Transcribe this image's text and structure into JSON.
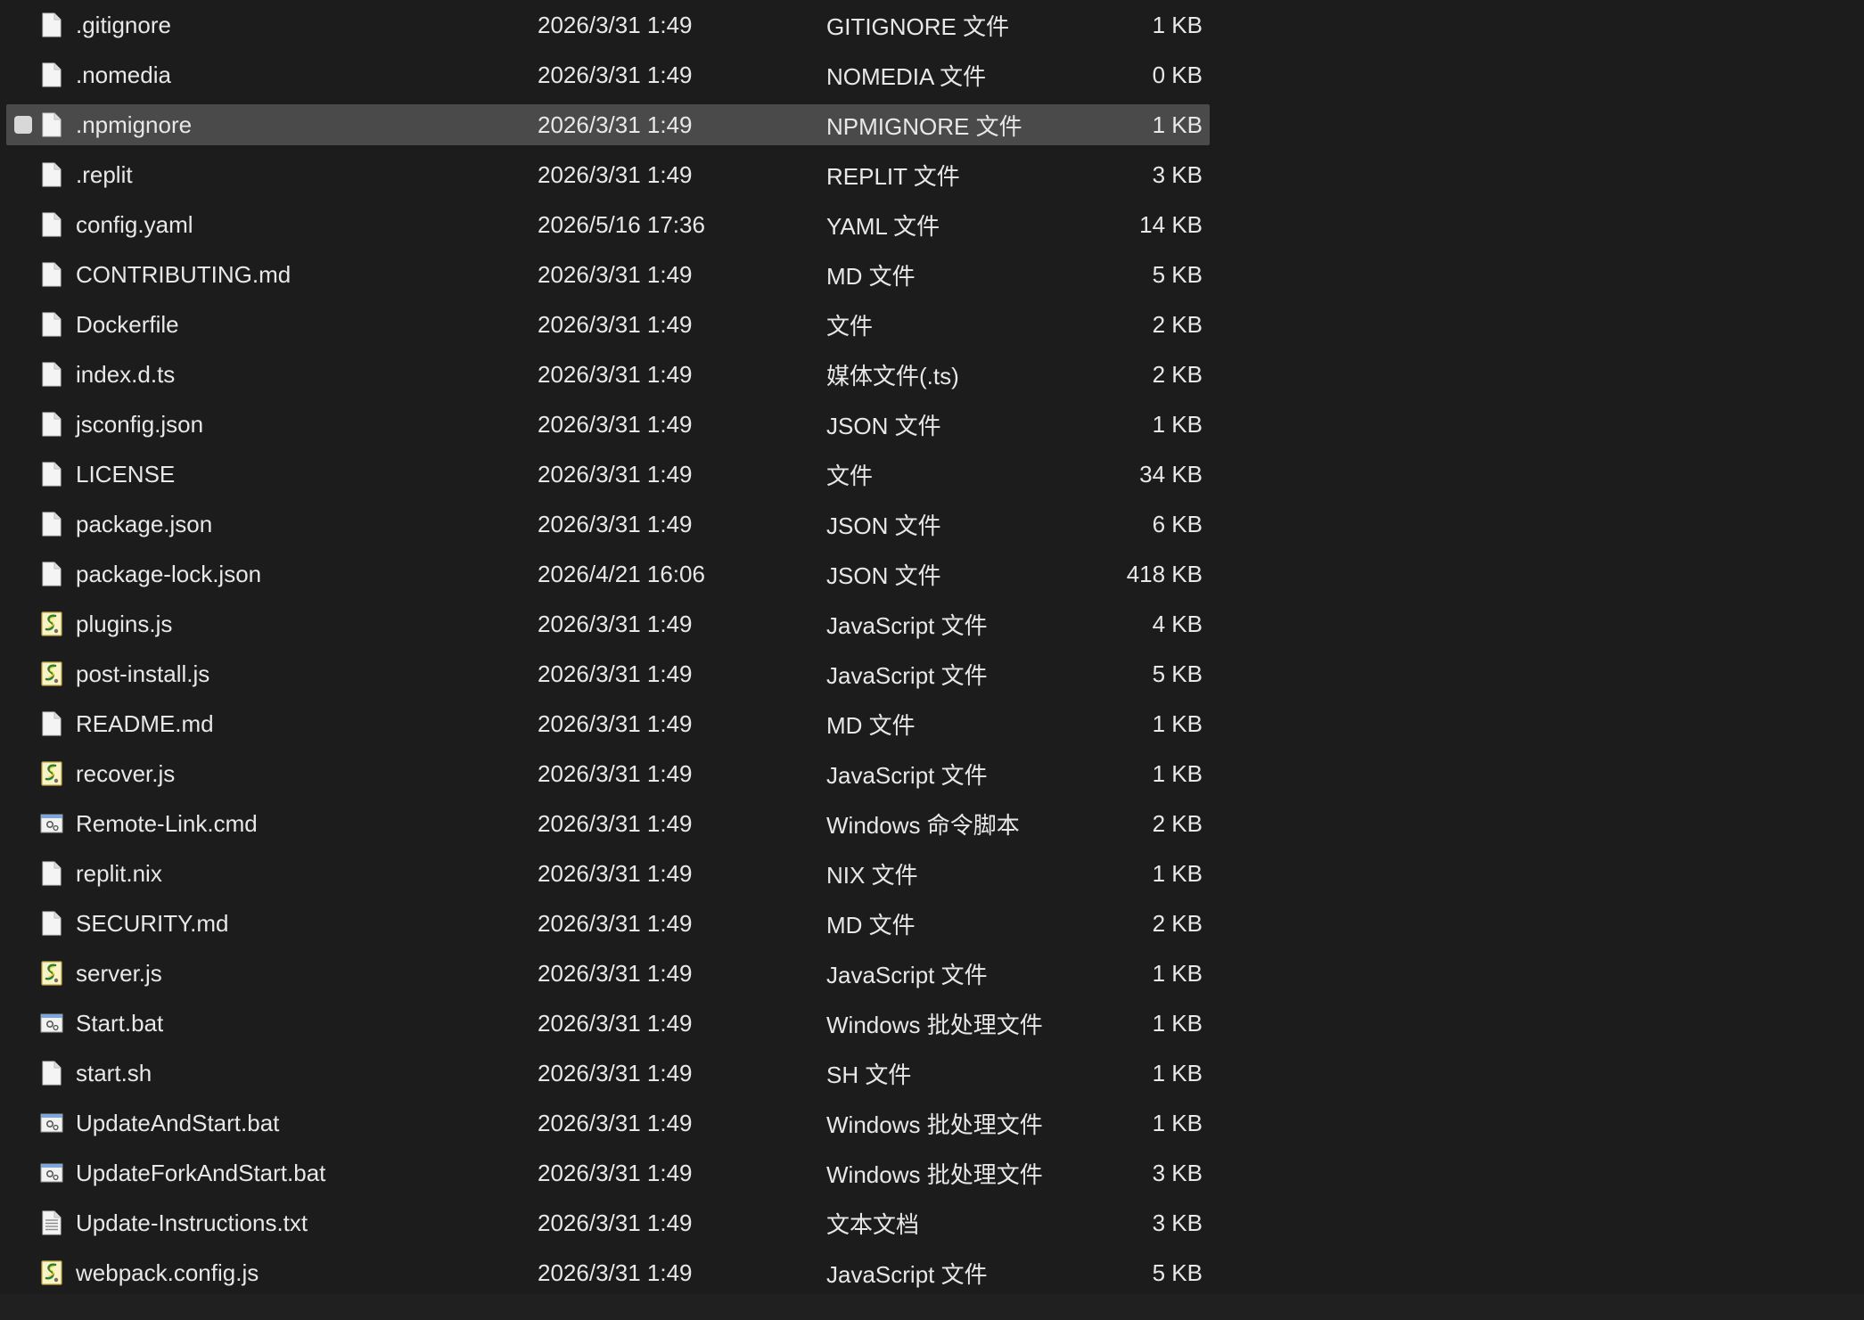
{
  "files": [
    {
      "name": ".gitignore",
      "date": "2026/3/31 1:49",
      "type": "GITIGNORE 文件",
      "size": "1 KB",
      "icon": "generic-file-icon",
      "selected": false
    },
    {
      "name": ".nomedia",
      "date": "2026/3/31 1:49",
      "type": "NOMEDIA 文件",
      "size": "0 KB",
      "icon": "generic-file-icon",
      "selected": false
    },
    {
      "name": ".npmignore",
      "date": "2026/3/31 1:49",
      "type": "NPMIGNORE 文件",
      "size": "1 KB",
      "icon": "generic-file-icon",
      "selected": true
    },
    {
      "name": ".replit",
      "date": "2026/3/31 1:49",
      "type": "REPLIT 文件",
      "size": "3 KB",
      "icon": "generic-file-icon",
      "selected": false
    },
    {
      "name": "config.yaml",
      "date": "2026/5/16 17:36",
      "type": "YAML 文件",
      "size": "14 KB",
      "icon": "generic-file-icon",
      "selected": false
    },
    {
      "name": "CONTRIBUTING.md",
      "date": "2026/3/31 1:49",
      "type": "MD 文件",
      "size": "5 KB",
      "icon": "generic-file-icon",
      "selected": false
    },
    {
      "name": "Dockerfile",
      "date": "2026/3/31 1:49",
      "type": "文件",
      "size": "2 KB",
      "icon": "generic-file-icon",
      "selected": false
    },
    {
      "name": "index.d.ts",
      "date": "2026/3/31 1:49",
      "type": "媒体文件(.ts)",
      "size": "2 KB",
      "icon": "generic-file-icon",
      "selected": false
    },
    {
      "name": "jsconfig.json",
      "date": "2026/3/31 1:49",
      "type": "JSON 文件",
      "size": "1 KB",
      "icon": "generic-file-icon",
      "selected": false
    },
    {
      "name": "LICENSE",
      "date": "2026/3/31 1:49",
      "type": "文件",
      "size": "34 KB",
      "icon": "generic-file-icon",
      "selected": false
    },
    {
      "name": "package.json",
      "date": "2026/3/31 1:49",
      "type": "JSON 文件",
      "size": "6 KB",
      "icon": "generic-file-icon",
      "selected": false
    },
    {
      "name": "package-lock.json",
      "date": "2026/4/21 16:06",
      "type": "JSON 文件",
      "size": "418 KB",
      "icon": "generic-file-icon",
      "selected": false
    },
    {
      "name": "plugins.js",
      "date": "2026/3/31 1:49",
      "type": "JavaScript 文件",
      "size": "4 KB",
      "icon": "javascript-file-icon",
      "selected": false
    },
    {
      "name": "post-install.js",
      "date": "2026/3/31 1:49",
      "type": "JavaScript 文件",
      "size": "5 KB",
      "icon": "javascript-file-icon",
      "selected": false
    },
    {
      "name": "README.md",
      "date": "2026/3/31 1:49",
      "type": "MD 文件",
      "size": "1 KB",
      "icon": "generic-file-icon",
      "selected": false
    },
    {
      "name": "recover.js",
      "date": "2026/3/31 1:49",
      "type": "JavaScript 文件",
      "size": "1 KB",
      "icon": "javascript-file-icon",
      "selected": false
    },
    {
      "name": "Remote-Link.cmd",
      "date": "2026/3/31 1:49",
      "type": "Windows 命令脚本",
      "size": "2 KB",
      "icon": "batch-script-icon",
      "selected": false
    },
    {
      "name": "replit.nix",
      "date": "2026/3/31 1:49",
      "type": "NIX 文件",
      "size": "1 KB",
      "icon": "generic-file-icon",
      "selected": false
    },
    {
      "name": "SECURITY.md",
      "date": "2026/3/31 1:49",
      "type": "MD 文件",
      "size": "2 KB",
      "icon": "generic-file-icon",
      "selected": false
    },
    {
      "name": "server.js",
      "date": "2026/3/31 1:49",
      "type": "JavaScript 文件",
      "size": "1 KB",
      "icon": "javascript-file-icon",
      "selected": false
    },
    {
      "name": "Start.bat",
      "date": "2026/3/31 1:49",
      "type": "Windows 批处理文件",
      "size": "1 KB",
      "icon": "batch-script-icon",
      "selected": false
    },
    {
      "name": "start.sh",
      "date": "2026/3/31 1:49",
      "type": "SH 文件",
      "size": "1 KB",
      "icon": "generic-file-icon",
      "selected": false
    },
    {
      "name": "UpdateAndStart.bat",
      "date": "2026/3/31 1:49",
      "type": "Windows 批处理文件",
      "size": "1 KB",
      "icon": "batch-script-icon",
      "selected": false
    },
    {
      "name": "UpdateForkAndStart.bat",
      "date": "2026/3/31 1:49",
      "type": "Windows 批处理文件",
      "size": "3 KB",
      "icon": "batch-script-icon",
      "selected": false
    },
    {
      "name": "Update-Instructions.txt",
      "date": "2026/3/31 1:49",
      "type": "文本文档",
      "size": "3 KB",
      "icon": "text-document-icon",
      "selected": false
    },
    {
      "name": "webpack.config.js",
      "date": "2026/3/31 1:49",
      "type": "JavaScript 文件",
      "size": "5 KB",
      "icon": "javascript-file-icon",
      "selected": false
    }
  ],
  "colors": {
    "background": "#1c1c1c",
    "selected_row": "#4a4a4a",
    "text": "#e8e8e8"
  }
}
